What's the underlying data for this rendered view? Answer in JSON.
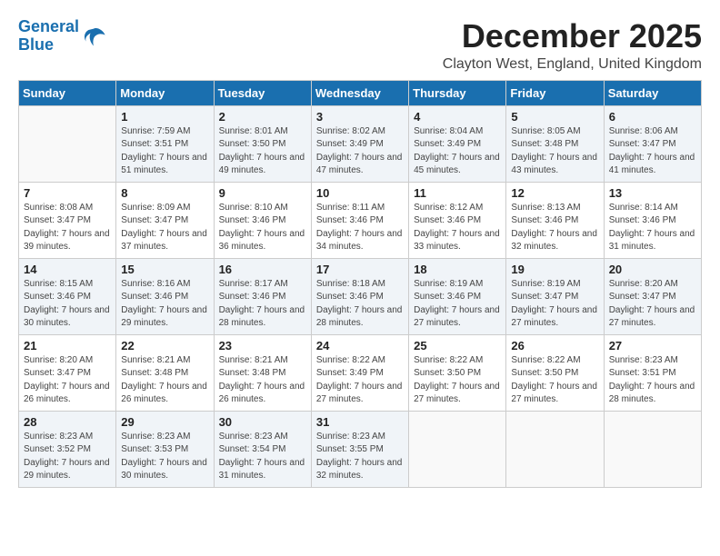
{
  "logo": {
    "text_general": "General",
    "text_blue": "Blue"
  },
  "header": {
    "month": "December 2025",
    "location": "Clayton West, England, United Kingdom"
  },
  "weekdays": [
    "Sunday",
    "Monday",
    "Tuesday",
    "Wednesday",
    "Thursday",
    "Friday",
    "Saturday"
  ],
  "weeks": [
    [
      {
        "day": "",
        "empty": true
      },
      {
        "day": "1",
        "sunrise": "Sunrise: 7:59 AM",
        "sunset": "Sunset: 3:51 PM",
        "daylight": "Daylight: 7 hours and 51 minutes."
      },
      {
        "day": "2",
        "sunrise": "Sunrise: 8:01 AM",
        "sunset": "Sunset: 3:50 PM",
        "daylight": "Daylight: 7 hours and 49 minutes."
      },
      {
        "day": "3",
        "sunrise": "Sunrise: 8:02 AM",
        "sunset": "Sunset: 3:49 PM",
        "daylight": "Daylight: 7 hours and 47 minutes."
      },
      {
        "day": "4",
        "sunrise": "Sunrise: 8:04 AM",
        "sunset": "Sunset: 3:49 PM",
        "daylight": "Daylight: 7 hours and 45 minutes."
      },
      {
        "day": "5",
        "sunrise": "Sunrise: 8:05 AM",
        "sunset": "Sunset: 3:48 PM",
        "daylight": "Daylight: 7 hours and 43 minutes."
      },
      {
        "day": "6",
        "sunrise": "Sunrise: 8:06 AM",
        "sunset": "Sunset: 3:47 PM",
        "daylight": "Daylight: 7 hours and 41 minutes."
      }
    ],
    [
      {
        "day": "7",
        "sunrise": "Sunrise: 8:08 AM",
        "sunset": "Sunset: 3:47 PM",
        "daylight": "Daylight: 7 hours and 39 minutes."
      },
      {
        "day": "8",
        "sunrise": "Sunrise: 8:09 AM",
        "sunset": "Sunset: 3:47 PM",
        "daylight": "Daylight: 7 hours and 37 minutes."
      },
      {
        "day": "9",
        "sunrise": "Sunrise: 8:10 AM",
        "sunset": "Sunset: 3:46 PM",
        "daylight": "Daylight: 7 hours and 36 minutes."
      },
      {
        "day": "10",
        "sunrise": "Sunrise: 8:11 AM",
        "sunset": "Sunset: 3:46 PM",
        "daylight": "Daylight: 7 hours and 34 minutes."
      },
      {
        "day": "11",
        "sunrise": "Sunrise: 8:12 AM",
        "sunset": "Sunset: 3:46 PM",
        "daylight": "Daylight: 7 hours and 33 minutes."
      },
      {
        "day": "12",
        "sunrise": "Sunrise: 8:13 AM",
        "sunset": "Sunset: 3:46 PM",
        "daylight": "Daylight: 7 hours and 32 minutes."
      },
      {
        "day": "13",
        "sunrise": "Sunrise: 8:14 AM",
        "sunset": "Sunset: 3:46 PM",
        "daylight": "Daylight: 7 hours and 31 minutes."
      }
    ],
    [
      {
        "day": "14",
        "sunrise": "Sunrise: 8:15 AM",
        "sunset": "Sunset: 3:46 PM",
        "daylight": "Daylight: 7 hours and 30 minutes."
      },
      {
        "day": "15",
        "sunrise": "Sunrise: 8:16 AM",
        "sunset": "Sunset: 3:46 PM",
        "daylight": "Daylight: 7 hours and 29 minutes."
      },
      {
        "day": "16",
        "sunrise": "Sunrise: 8:17 AM",
        "sunset": "Sunset: 3:46 PM",
        "daylight": "Daylight: 7 hours and 28 minutes."
      },
      {
        "day": "17",
        "sunrise": "Sunrise: 8:18 AM",
        "sunset": "Sunset: 3:46 PM",
        "daylight": "Daylight: 7 hours and 28 minutes."
      },
      {
        "day": "18",
        "sunrise": "Sunrise: 8:19 AM",
        "sunset": "Sunset: 3:46 PM",
        "daylight": "Daylight: 7 hours and 27 minutes."
      },
      {
        "day": "19",
        "sunrise": "Sunrise: 8:19 AM",
        "sunset": "Sunset: 3:47 PM",
        "daylight": "Daylight: 7 hours and 27 minutes."
      },
      {
        "day": "20",
        "sunrise": "Sunrise: 8:20 AM",
        "sunset": "Sunset: 3:47 PM",
        "daylight": "Daylight: 7 hours and 27 minutes."
      }
    ],
    [
      {
        "day": "21",
        "sunrise": "Sunrise: 8:20 AM",
        "sunset": "Sunset: 3:47 PM",
        "daylight": "Daylight: 7 hours and 26 minutes."
      },
      {
        "day": "22",
        "sunrise": "Sunrise: 8:21 AM",
        "sunset": "Sunset: 3:48 PM",
        "daylight": "Daylight: 7 hours and 26 minutes."
      },
      {
        "day": "23",
        "sunrise": "Sunrise: 8:21 AM",
        "sunset": "Sunset: 3:48 PM",
        "daylight": "Daylight: 7 hours and 26 minutes."
      },
      {
        "day": "24",
        "sunrise": "Sunrise: 8:22 AM",
        "sunset": "Sunset: 3:49 PM",
        "daylight": "Daylight: 7 hours and 27 minutes."
      },
      {
        "day": "25",
        "sunrise": "Sunrise: 8:22 AM",
        "sunset": "Sunset: 3:50 PM",
        "daylight": "Daylight: 7 hours and 27 minutes."
      },
      {
        "day": "26",
        "sunrise": "Sunrise: 8:22 AM",
        "sunset": "Sunset: 3:50 PM",
        "daylight": "Daylight: 7 hours and 27 minutes."
      },
      {
        "day": "27",
        "sunrise": "Sunrise: 8:23 AM",
        "sunset": "Sunset: 3:51 PM",
        "daylight": "Daylight: 7 hours and 28 minutes."
      }
    ],
    [
      {
        "day": "28",
        "sunrise": "Sunrise: 8:23 AM",
        "sunset": "Sunset: 3:52 PM",
        "daylight": "Daylight: 7 hours and 29 minutes."
      },
      {
        "day": "29",
        "sunrise": "Sunrise: 8:23 AM",
        "sunset": "Sunset: 3:53 PM",
        "daylight": "Daylight: 7 hours and 30 minutes."
      },
      {
        "day": "30",
        "sunrise": "Sunrise: 8:23 AM",
        "sunset": "Sunset: 3:54 PM",
        "daylight": "Daylight: 7 hours and 31 minutes."
      },
      {
        "day": "31",
        "sunrise": "Sunrise: 8:23 AM",
        "sunset": "Sunset: 3:55 PM",
        "daylight": "Daylight: 7 hours and 32 minutes."
      },
      {
        "day": "",
        "empty": true
      },
      {
        "day": "",
        "empty": true
      },
      {
        "day": "",
        "empty": true
      }
    ]
  ]
}
